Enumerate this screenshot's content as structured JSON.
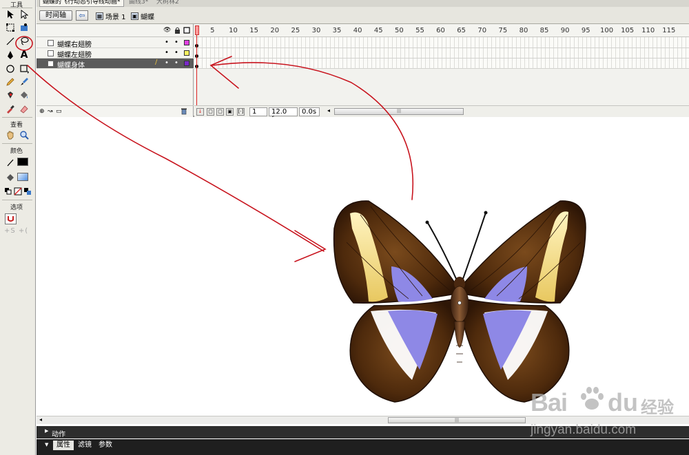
{
  "toolbox": {
    "title": "工具",
    "view_label": "查看",
    "colors_label": "颜色",
    "options_label": "选项"
  },
  "doc_tabs": [
    {
      "label": "蝴蝶的飞行动态引导线动画*"
    },
    {
      "label": "曲线3*"
    },
    {
      "label": "大树林2"
    }
  ],
  "edit_bar": {
    "timeline_button": "时间轴",
    "scene_label": "场景 1",
    "symbol_label": "蝴蝶"
  },
  "timeline": {
    "layers": [
      {
        "name": "蝴蝶右翅膀",
        "color": "#e040e0"
      },
      {
        "name": "蝴蝶左翅膀",
        "color": "#f6f060"
      },
      {
        "name": "蝴蝶身体",
        "color": "#7a2ac8",
        "selected": true
      }
    ],
    "ruler_numbers": [
      "5",
      "10",
      "15",
      "20",
      "25",
      "30",
      "35",
      "40",
      "45",
      "50",
      "55",
      "60",
      "65",
      "70",
      "75",
      "80",
      "85",
      "90",
      "95",
      "100",
      "105",
      "110",
      "115"
    ],
    "current_frame": "1",
    "fps": "12.0 fps",
    "elapsed": "0.0s"
  },
  "bottom": {
    "actions_label": "动作",
    "tabs": [
      "属性",
      "滤镜",
      "参数"
    ]
  },
  "watermark": {
    "brand_left": "Bai",
    "brand_right": "du",
    "brand_cn": "经验",
    "url": "jingyan.baidu.com"
  },
  "colors": {
    "annotation_red": "#c8141e",
    "selected_layer": "#5b5b5b"
  }
}
